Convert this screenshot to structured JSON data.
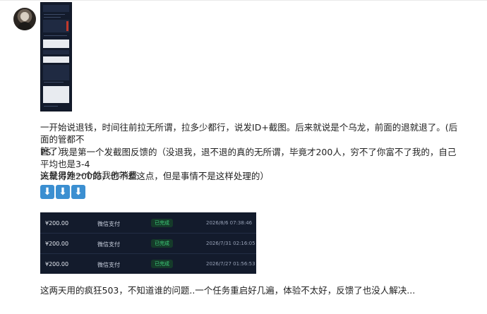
{
  "post": {
    "paragraph1": "一开始说退钱，时间往前拉无所谓，拉多少都行，说发ID+截图。后来就说是个乌龙，前面的退就退了。(后面的管都不",
    "paragraph1_cont": "管了）",
    "paragraph2": "PS：我是第一个发截图反馈的（没退我，退不退的真的无所谓，毕竟才200人，穷不了你富不了我的，自己平均也是3-4",
    "paragraph2_cont": "天就得跑200的，也不差这点，但是事情不是这样处理的）",
    "paragraph3": "这是另外一个站我的消费",
    "arrows": [
      "⬇",
      "⬇",
      "⬇"
    ],
    "paragraph4": "这两天用的疯狂503，不知道谁的问题..一个任务重启好几遍，体验不太好，反馈了也没人解决..."
  },
  "payments": [
    {
      "amount": "¥200.00",
      "method": "微信支付",
      "status": "已完成",
      "time": "2026/8/6 07:38:46"
    },
    {
      "amount": "¥200.00",
      "method": "微信支付",
      "status": "已完成",
      "time": "2026/7/31 02:16:05"
    },
    {
      "amount": "¥200.00",
      "method": "微信支付",
      "status": "已完成",
      "time": "2026/7/27 01:56:53"
    }
  ],
  "colors": {
    "table_bg": "#131b2c",
    "status_green": "#3ecf7a",
    "arrow_blue": "#3b8fd1"
  }
}
